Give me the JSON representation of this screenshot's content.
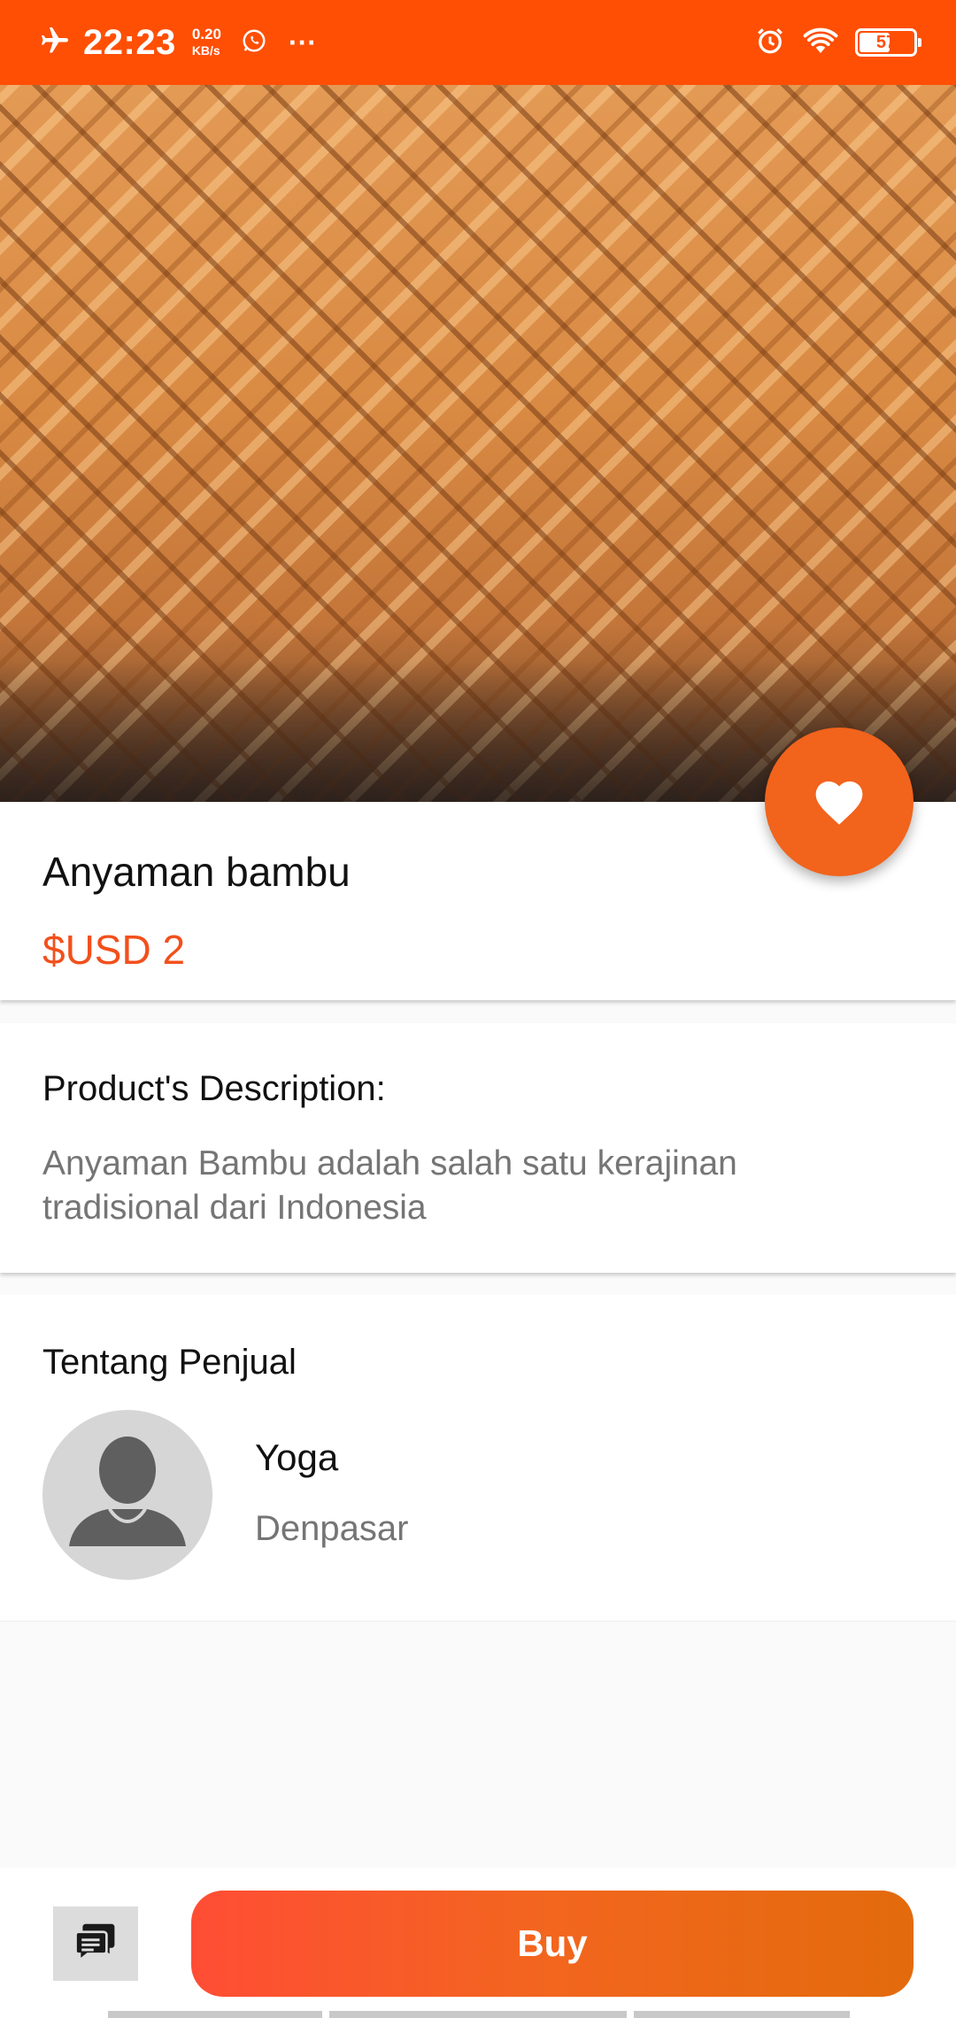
{
  "status_bar": {
    "time": "22:23",
    "speed_value": "0.20",
    "speed_unit": "KB/s",
    "more": "···",
    "battery_level": "57"
  },
  "product": {
    "name": "Anyaman bambu",
    "price": "$USD 2"
  },
  "description": {
    "heading": "Product's Description:",
    "text": "Anyaman Bambu adalah salah satu kerajinan tradisional dari Indonesia"
  },
  "seller": {
    "heading": "Tentang Penjual",
    "name": "Yoga",
    "city": "Denpasar"
  },
  "actions": {
    "buy_label": "Buy"
  },
  "icons": {
    "airplane": "airplane-icon",
    "whatsapp": "whatsapp-icon",
    "alarm": "alarm-icon",
    "wifi": "wifi-icon",
    "favorite": "heart-icon",
    "chat": "chat-icon",
    "avatar": "person-icon"
  },
  "colors": {
    "status_bar": "#ff4f05",
    "accent": "#f2631c",
    "price": "#f2501c"
  }
}
